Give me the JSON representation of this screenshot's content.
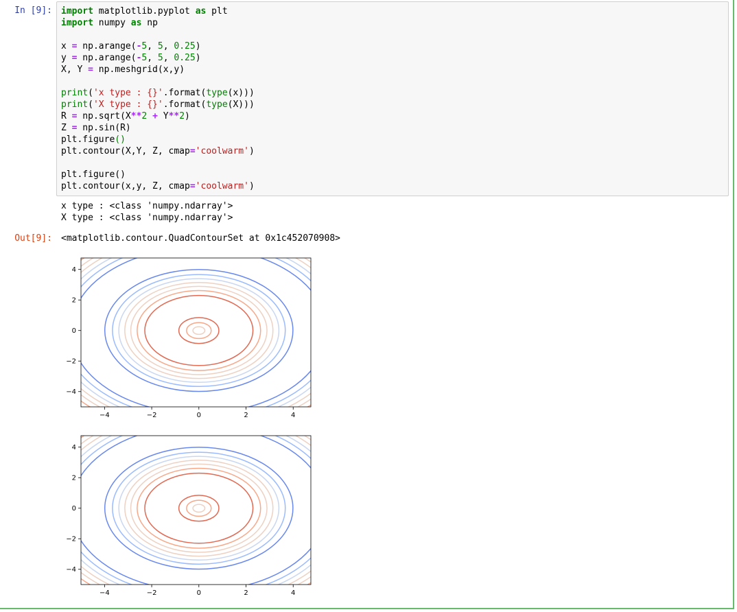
{
  "cell": {
    "in_prompt": "In [9]:",
    "out_prompt": "Out[9]:",
    "code_lines": [
      [
        {
          "t": "import",
          "c": "kw"
        },
        {
          "t": " matplotlib.pyplot "
        },
        {
          "t": "as",
          "c": "kw"
        },
        {
          "t": " plt"
        }
      ],
      [
        {
          "t": "import",
          "c": "kw"
        },
        {
          "t": " numpy "
        },
        {
          "t": "as",
          "c": "kw"
        },
        {
          "t": " np"
        }
      ],
      [],
      [
        {
          "t": "x "
        },
        {
          "t": "=",
          "c": "op"
        },
        {
          "t": " np.arange("
        },
        {
          "t": "-",
          "c": "op"
        },
        {
          "t": "5",
          "c": "num"
        },
        {
          "t": ", "
        },
        {
          "t": "5",
          "c": "num"
        },
        {
          "t": ", "
        },
        {
          "t": "0.25",
          "c": "num"
        },
        {
          "t": ")"
        }
      ],
      [
        {
          "t": "y "
        },
        {
          "t": "=",
          "c": "op"
        },
        {
          "t": " np.arange("
        },
        {
          "t": "-",
          "c": "op"
        },
        {
          "t": "5",
          "c": "num"
        },
        {
          "t": ", "
        },
        {
          "t": "5",
          "c": "num"
        },
        {
          "t": ", "
        },
        {
          "t": "0.25",
          "c": "num"
        },
        {
          "t": ")"
        }
      ],
      [
        {
          "t": "X, Y "
        },
        {
          "t": "=",
          "c": "op"
        },
        {
          "t": " np.meshgrid(x,y)"
        }
      ],
      [],
      [
        {
          "t": "print",
          "c": "bi"
        },
        {
          "t": "("
        },
        {
          "t": "'x type : {}'",
          "c": "str"
        },
        {
          "t": ".format("
        },
        {
          "t": "type",
          "c": "bi"
        },
        {
          "t": "(x)))"
        }
      ],
      [
        {
          "t": "print",
          "c": "bi"
        },
        {
          "t": "("
        },
        {
          "t": "'X type : {}'",
          "c": "str"
        },
        {
          "t": ".format("
        },
        {
          "t": "type",
          "c": "bi"
        },
        {
          "t": "(X)))"
        }
      ],
      [
        {
          "t": "R "
        },
        {
          "t": "=",
          "c": "op"
        },
        {
          "t": " np.sqrt(X"
        },
        {
          "t": "**",
          "c": "op"
        },
        {
          "t": "2",
          "c": "num"
        },
        {
          "t": " "
        },
        {
          "t": "+",
          "c": "op"
        },
        {
          "t": " Y"
        },
        {
          "t": "**",
          "c": "op"
        },
        {
          "t": "2",
          "c": "num"
        },
        {
          "t": ")"
        }
      ],
      [
        {
          "t": "Z "
        },
        {
          "t": "=",
          "c": "op"
        },
        {
          "t": " np.sin(R)"
        }
      ],
      [
        {
          "t": "plt.figure"
        },
        {
          "t": "()",
          "c": "num"
        }
      ],
      [
        {
          "t": "plt.contour(X,Y, Z, cmap"
        },
        {
          "t": "=",
          "c": "op"
        },
        {
          "t": "'coolwarm'",
          "c": "str"
        },
        {
          "t": ")"
        }
      ],
      [],
      [
        {
          "t": "plt.figure()"
        }
      ],
      [
        {
          "t": "plt.contour(x,y, Z, cmap"
        },
        {
          "t": "=",
          "c": "op"
        },
        {
          "t": "'coolwarm'",
          "c": "str"
        },
        {
          "t": ")"
        }
      ]
    ],
    "stdout_lines": [
      "x type : <class 'numpy.ndarray'>",
      "X type : <class 'numpy.ndarray'>"
    ],
    "out_text": "<matplotlib.contour.QuadContourSet at 0x1c452070908>"
  },
  "chart_data": [
    {
      "type": "contour",
      "function": "sin(sqrt(x^2 + y^2))",
      "colormap": "coolwarm",
      "levels": [
        -1.0,
        -0.75,
        -0.5,
        -0.25,
        0.0,
        0.25,
        0.5,
        0.75,
        1.0
      ],
      "level_colors": [
        "#3b4cc0",
        "#6788ee",
        "#9abbff",
        "#c9d7f0",
        "#edd1c2",
        "#f7a889",
        "#e26952",
        "#b40426"
      ],
      "xlim": [
        -5,
        4.75
      ],
      "ylim": [
        -5,
        4.75
      ],
      "xticks": [
        -4,
        -2,
        0,
        2,
        4
      ],
      "yticks": [
        -4,
        -2,
        0,
        2,
        4
      ],
      "xticklabels": [
        "−4",
        "−2",
        "0",
        "2",
        "4"
      ],
      "yticklabels": [
        "−4",
        "−2",
        "0",
        "2",
        "4"
      ]
    },
    {
      "type": "contour",
      "function": "sin(sqrt(x^2 + y^2))",
      "colormap": "coolwarm",
      "levels": [
        -1.0,
        -0.75,
        -0.5,
        -0.25,
        0.0,
        0.25,
        0.5,
        0.75,
        1.0
      ],
      "level_colors": [
        "#3b4cc0",
        "#6788ee",
        "#9abbff",
        "#c9d7f0",
        "#edd1c2",
        "#f7a889",
        "#e26952",
        "#b40426"
      ],
      "xlim": [
        -5,
        4.75
      ],
      "ylim": [
        -5,
        4.75
      ],
      "xticks": [
        -4,
        -2,
        0,
        2,
        4
      ],
      "yticks": [
        -4,
        -2,
        0,
        2,
        4
      ],
      "xticklabels": [
        "−4",
        "−2",
        "0",
        "2",
        "4"
      ],
      "yticklabels": [
        "−4",
        "−2",
        "0",
        "2",
        "4"
      ]
    }
  ]
}
